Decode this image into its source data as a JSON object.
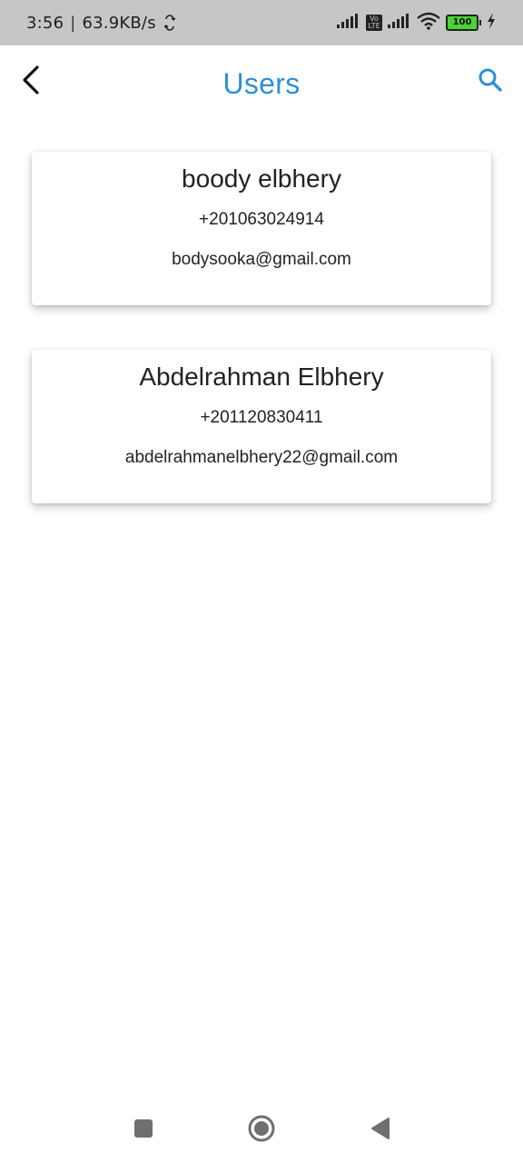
{
  "status_bar": {
    "time": "3:56",
    "separator": "|",
    "net_speed": "63.9KB/s",
    "battery_level": "100",
    "battery_color": "#4cd137",
    "volte_label": "Vo LTE",
    "icons": [
      "sync-icon",
      "signal-icon",
      "volte-icon",
      "signal-icon",
      "wifi-icon",
      "battery-icon",
      "charging-icon"
    ]
  },
  "app_bar": {
    "title": "Users",
    "accent_color": "#2e8fd8",
    "back_icon": "chevron-left-icon",
    "search_icon": "search-icon"
  },
  "users": [
    {
      "name": "boody elbhery",
      "phone": "+201063024914",
      "email": "bodysooka@gmail.com"
    },
    {
      "name": "Abdelrahman Elbhery",
      "phone": "+201120830411",
      "email": "abdelrahmanelbhery22@gmail.com"
    }
  ],
  "nav_bar": {
    "icons": [
      "recents-square-icon",
      "home-circle-icon",
      "back-triangle-icon"
    ]
  }
}
